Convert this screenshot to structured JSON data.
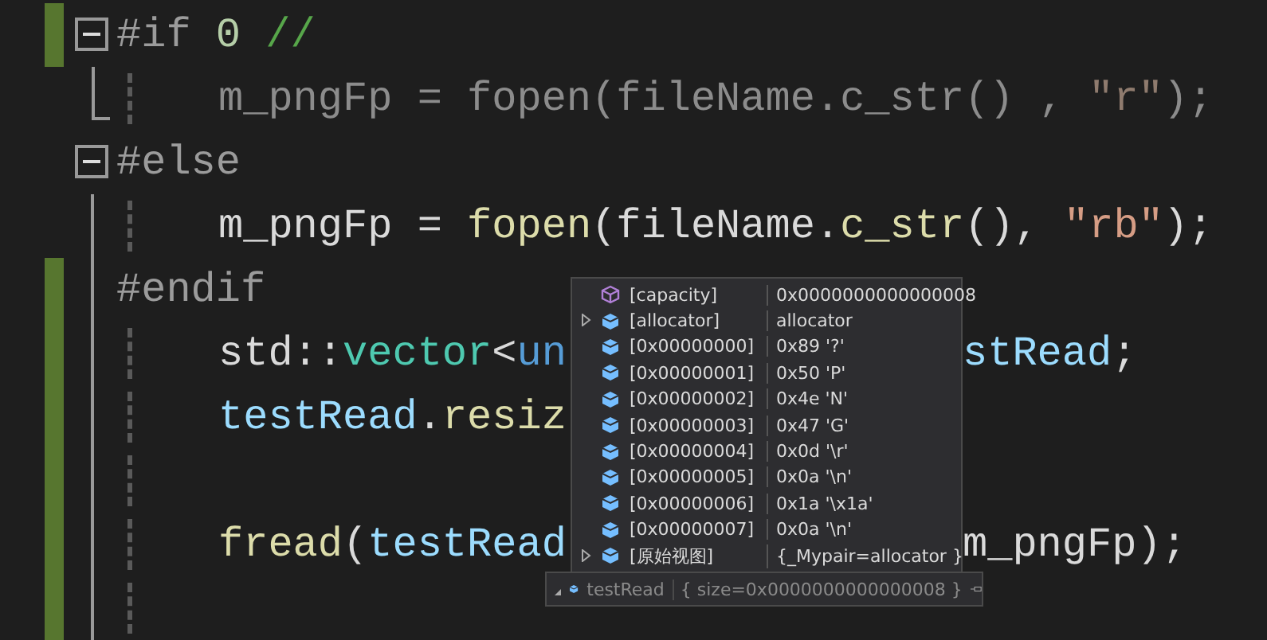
{
  "editor": {
    "lines": [
      {
        "kind": "directive",
        "changed": true,
        "expanded": true,
        "tokens": [
          {
            "text": "#if ",
            "kind": "directive"
          },
          {
            "text": "0",
            "kind": "number"
          },
          {
            "text": " //",
            "kind": "comment"
          }
        ]
      },
      {
        "kind": "code",
        "changed": false,
        "tokens": [
          {
            "text": "m_pngFp = fopen(fileName.c_str() , ",
            "kind": "inactive"
          },
          {
            "text": "\"r\"",
            "kind": "inactive_string"
          },
          {
            "text": ");",
            "kind": "inactive"
          }
        ]
      },
      {
        "kind": "directive",
        "changed": false,
        "expanded": true,
        "tokens": [
          {
            "text": "#else",
            "kind": "directive"
          }
        ]
      },
      {
        "kind": "code",
        "changed": false,
        "tokens": [
          {
            "text": "m_pngFp = ",
            "kind": "plain"
          },
          {
            "text": "fopen",
            "kind": "function"
          },
          {
            "text": "(fileName.",
            "kind": "plain"
          },
          {
            "text": "c_str",
            "kind": "function"
          },
          {
            "text": "(), ",
            "kind": "plain"
          },
          {
            "text": "\"rb\"",
            "kind": "string"
          },
          {
            "text": ");",
            "kind": "plain"
          }
        ]
      },
      {
        "kind": "directive",
        "changed": true,
        "tokens": [
          {
            "text": "#endif",
            "kind": "directive"
          }
        ]
      },
      {
        "kind": "code",
        "changed": true,
        "tokens": [
          {
            "text": "std::",
            "kind": "plain"
          },
          {
            "text": "vector",
            "kind": "type"
          },
          {
            "text": "<",
            "kind": "plain"
          },
          {
            "text": "un",
            "kind": "keyword"
          }
        ],
        "tail": [
          {
            "text": "stRead",
            "kind": "variable"
          },
          {
            "text": ";",
            "kind": "plain"
          }
        ]
      },
      {
        "kind": "code",
        "changed": true,
        "tokens": [
          {
            "text": "testRead",
            "kind": "variable"
          },
          {
            "text": ".",
            "kind": "plain"
          },
          {
            "text": "resiz",
            "kind": "function"
          }
        ]
      },
      {
        "kind": "code",
        "changed": true
      },
      {
        "kind": "code",
        "changed": true,
        "tokens": [
          {
            "text": "fread",
            "kind": "function"
          },
          {
            "text": "(",
            "kind": "plain"
          },
          {
            "text": "testRead",
            "kind": "variable"
          }
        ],
        "tail": [
          {
            "text": "m_pngFp",
            "kind": "plain"
          },
          {
            "text": ");",
            "kind": "plain"
          }
        ]
      },
      {
        "kind": "code",
        "changed": true
      }
    ]
  },
  "datatip": {
    "items": [
      {
        "kind": "property",
        "expandable": false,
        "name": "[capacity]",
        "value": "0x0000000000000008"
      },
      {
        "kind": "field",
        "expandable": true,
        "name": "[allocator]",
        "value": "allocator"
      },
      {
        "kind": "field",
        "expandable": false,
        "name": "[0x00000000]",
        "value": "0x89 '?'"
      },
      {
        "kind": "field",
        "expandable": false,
        "name": "[0x00000001]",
        "value": "0x50 'P'"
      },
      {
        "kind": "field",
        "expandable": false,
        "name": "[0x00000002]",
        "value": "0x4e 'N'"
      },
      {
        "kind": "field",
        "expandable": false,
        "name": "[0x00000003]",
        "value": "0x47 'G'"
      },
      {
        "kind": "field",
        "expandable": false,
        "name": "[0x00000004]",
        "value": "0x0d '\\r'"
      },
      {
        "kind": "field",
        "expandable": false,
        "name": "[0x00000005]",
        "value": "0x0a '\\n'"
      },
      {
        "kind": "field",
        "expandable": false,
        "name": "[0x00000006]",
        "value": "0x1a '\\x1a'"
      },
      {
        "kind": "field",
        "expandable": false,
        "name": "[0x00000007]",
        "value": "0x0a '\\n'"
      },
      {
        "kind": "field",
        "expandable": true,
        "name": "[原始视图]",
        "value": "{_Mypair=allocator }"
      }
    ],
    "root": {
      "expanded": true,
      "name": "testRead",
      "value": "{ size=0x0000000000000008 }"
    }
  }
}
